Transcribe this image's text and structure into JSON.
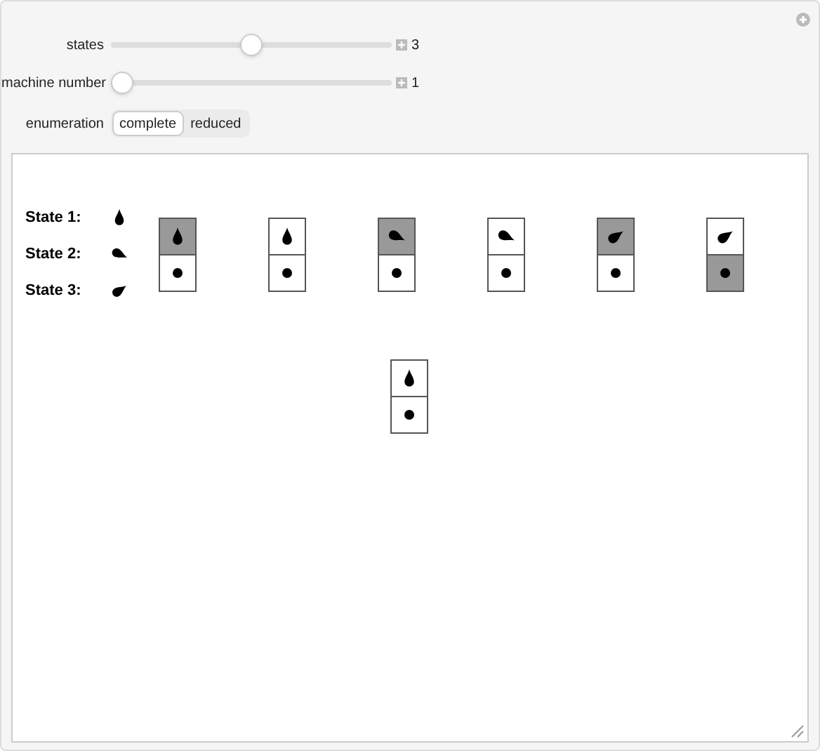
{
  "sliders": [
    {
      "label": "states",
      "level": 0.5,
      "value": "3"
    },
    {
      "label": "machine number",
      "level": 0,
      "value": "1"
    }
  ],
  "enumeration": {
    "label": "enumeration",
    "options": [
      {
        "label": "complete",
        "selected": true
      },
      {
        "label": "reduced",
        "selected": false
      }
    ]
  },
  "legend": [
    {
      "label": "State 1:",
      "kind": "state1"
    },
    {
      "label": "State 2:",
      "kind": "state2"
    },
    {
      "label": "State 3:",
      "kind": "state3"
    }
  ],
  "rules": [
    {
      "kind": "state1",
      "top_shaded": true,
      "bottom_shaded": false
    },
    {
      "kind": "state1",
      "top_shaded": false,
      "bottom_shaded": false
    },
    {
      "kind": "state2",
      "top_shaded": true,
      "bottom_shaded": false
    },
    {
      "kind": "state2",
      "top_shaded": false,
      "bottom_shaded": false
    },
    {
      "kind": "state3",
      "top_shaded": true,
      "bottom_shaded": false
    },
    {
      "kind": "state3",
      "top_shaded": false,
      "bottom_shaded": true
    }
  ],
  "result": {
    "kind": "state1",
    "top_shaded": false,
    "bottom_shaded": false
  }
}
